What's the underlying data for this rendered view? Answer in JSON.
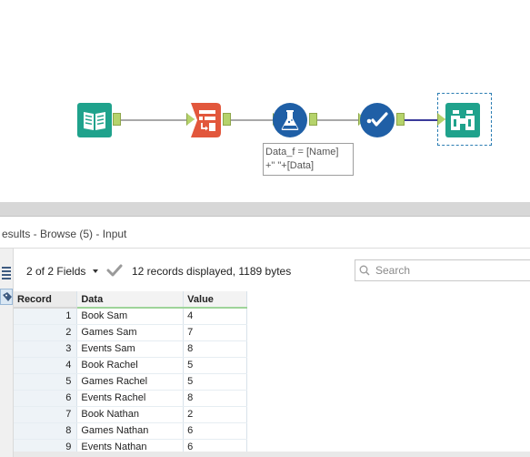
{
  "workflow": {
    "annotation": "Data_f = [Name]\n+\" \"+[Data]"
  },
  "results": {
    "title": "esults - Browse (5) - Input",
    "fields_label": "2 of 2 Fields",
    "records_info": "12 records displayed, 1189 bytes",
    "search_placeholder": "Search",
    "columns": [
      "Record",
      "Data",
      "Value"
    ],
    "rows": [
      {
        "record": "1",
        "data": "Book Sam",
        "value": "4"
      },
      {
        "record": "2",
        "data": "Games Sam",
        "value": "7"
      },
      {
        "record": "3",
        "data": "Events Sam",
        "value": "8"
      },
      {
        "record": "4",
        "data": "Book Rachel",
        "value": "5"
      },
      {
        "record": "5",
        "data": "Games Rachel",
        "value": "5"
      },
      {
        "record": "6",
        "data": "Events Rachel",
        "value": "8"
      },
      {
        "record": "7",
        "data": "Book Nathan",
        "value": "2"
      },
      {
        "record": "8",
        "data": "Games Nathan",
        "value": "6"
      },
      {
        "record": "9",
        "data": "Events Nathan",
        "value": "6"
      }
    ]
  },
  "colors": {
    "input_tool": "#1fa28c",
    "select_tool": "#e2573c",
    "formula_tool": "#1f5fa6",
    "filter_tool": "#1f5fa6",
    "browse_tool": "#1fa28c",
    "anchor": "#b5d36b",
    "selected_connection": "#3a3a9a"
  }
}
